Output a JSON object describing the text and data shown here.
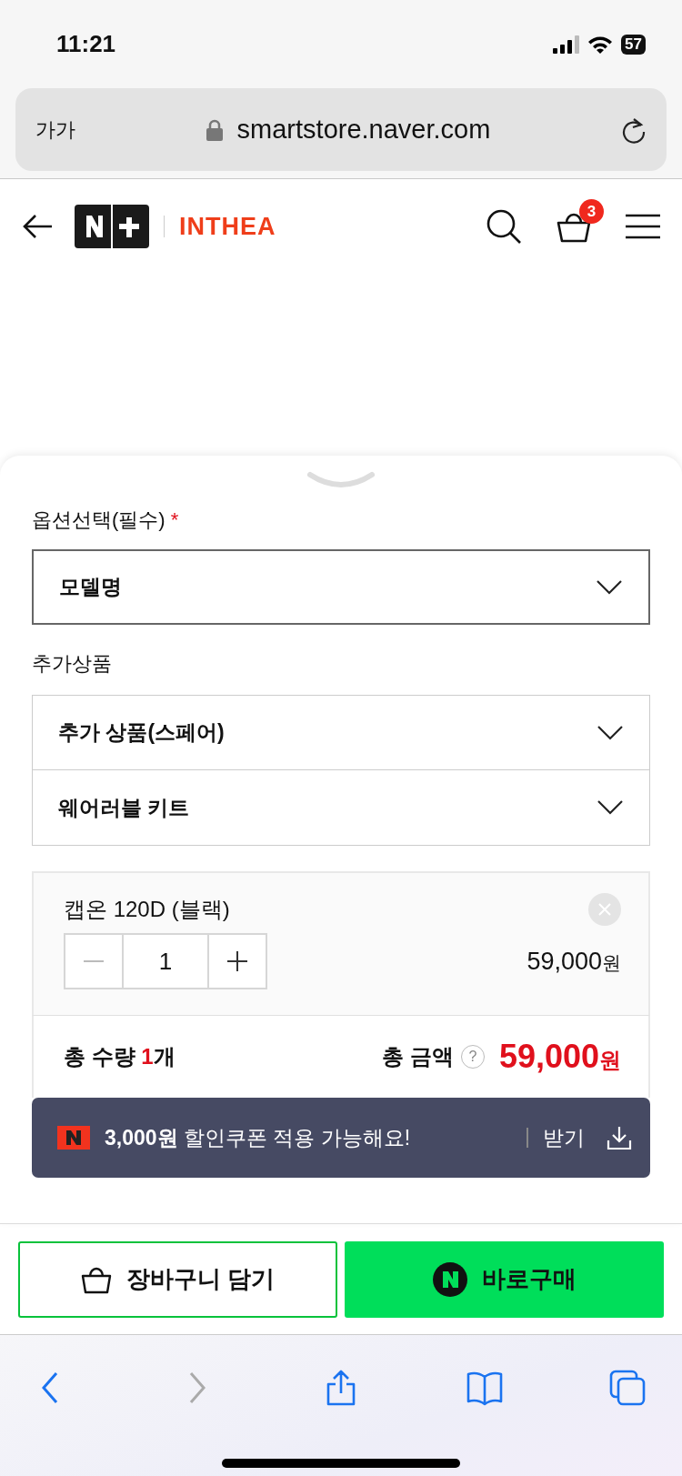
{
  "status_bar": {
    "time": "11:21",
    "battery": "57"
  },
  "browser": {
    "text_size": "가가",
    "url": "smartstore.naver.com"
  },
  "header": {
    "brand": "INTHEA",
    "cart_count": "3"
  },
  "options": {
    "label": "옵션선택(필수)",
    "required_mark": "*",
    "select": "모델명"
  },
  "additional": {
    "label": "추가상품",
    "selects": [
      "추가 상품(스페어)",
      "웨어러블 키트"
    ]
  },
  "item": {
    "name": "캡온 120D (블랙)",
    "quantity": "1",
    "price": "59,000",
    "price_unit": "원"
  },
  "total": {
    "quantity_label": "총 수량",
    "quantity": "1",
    "quantity_unit": "개",
    "amount_label": "총 금액",
    "help": "?",
    "amount": "59,000",
    "amount_unit": "원"
  },
  "coupon": {
    "amount": "3,000원",
    "message": "할인쿠폰 적용 가능해요!",
    "action": "받기"
  },
  "buttons": [
    {
      "kind": "cart",
      "label": "장바구니 담기"
    },
    {
      "kind": "buy",
      "label": "바로구매"
    }
  ],
  "toolbar": [
    {
      "kind": "back",
      "disabled": false
    },
    {
      "kind": "forward",
      "disabled": true
    },
    {
      "kind": "share",
      "disabled": false
    },
    {
      "kind": "bookmarks",
      "disabled": false
    },
    {
      "kind": "tabs",
      "disabled": false
    }
  ]
}
